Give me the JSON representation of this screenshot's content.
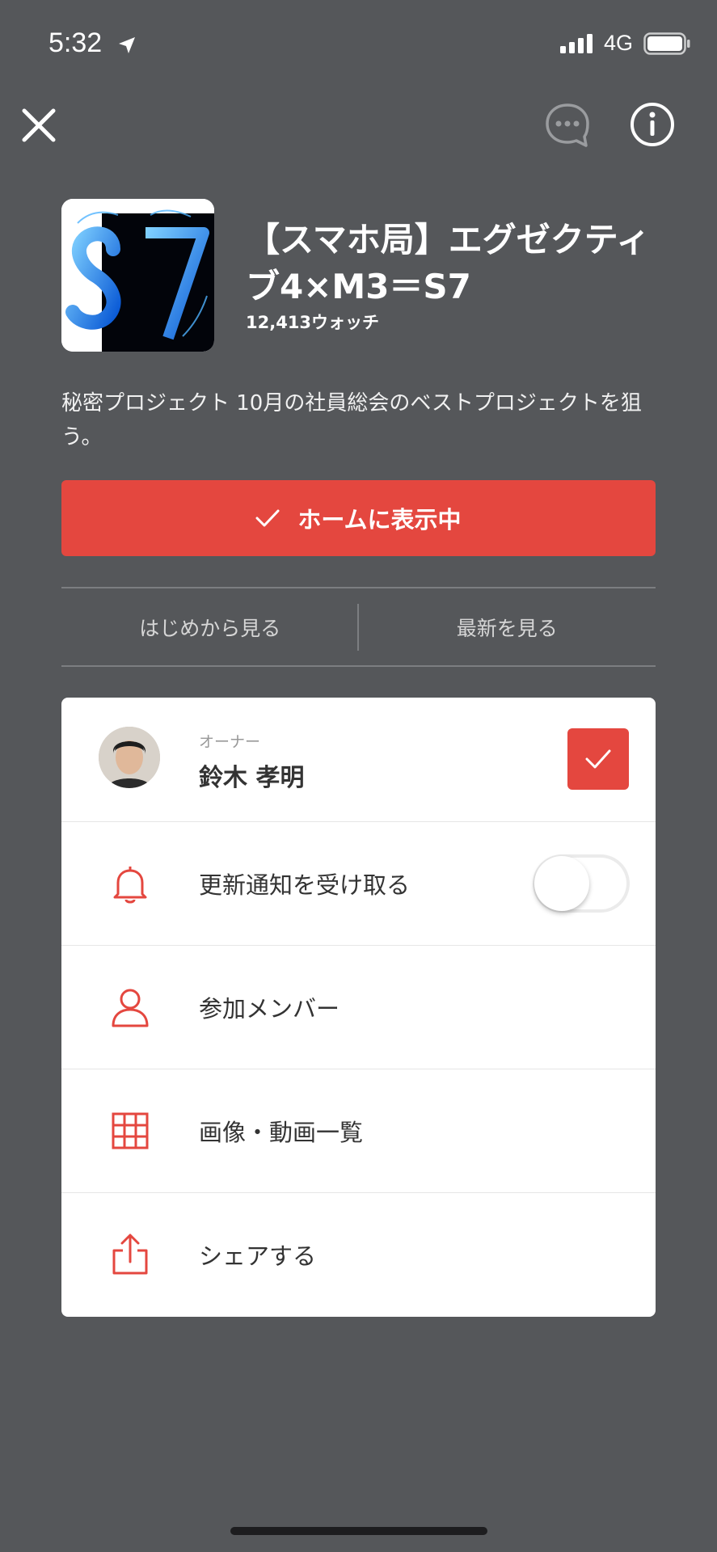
{
  "status_bar": {
    "time": "5:32",
    "network": "4G"
  },
  "header": {
    "title": "【スマホ局】エグゼクティブ4×M3＝S7",
    "watch_count": "12,413ウォッチ",
    "description": "秘密プロジェクト 10月の社員総会のベストプロジェクトを狙う。"
  },
  "home_button": {
    "label": "ホームに表示中"
  },
  "view_links": {
    "from_start": "はじめから見る",
    "latest": "最新を見る"
  },
  "menu": {
    "owner": {
      "caption": "オーナー",
      "name": "鈴木 孝明",
      "checked": true
    },
    "notify": {
      "label": "更新通知を受け取る",
      "enabled": false
    },
    "members": {
      "label": "参加メンバー"
    },
    "media": {
      "label": "画像・動画一覧"
    },
    "share": {
      "label": "シェアする"
    }
  },
  "colors": {
    "background": "#55575a",
    "accent": "#e4473f",
    "card": "#ffffff"
  },
  "icons": [
    "location-arrow-icon",
    "signal-icon",
    "battery-icon",
    "close-icon",
    "chat-icon",
    "info-icon",
    "check-icon",
    "bell-icon",
    "person-icon",
    "grid-icon",
    "share-icon"
  ]
}
